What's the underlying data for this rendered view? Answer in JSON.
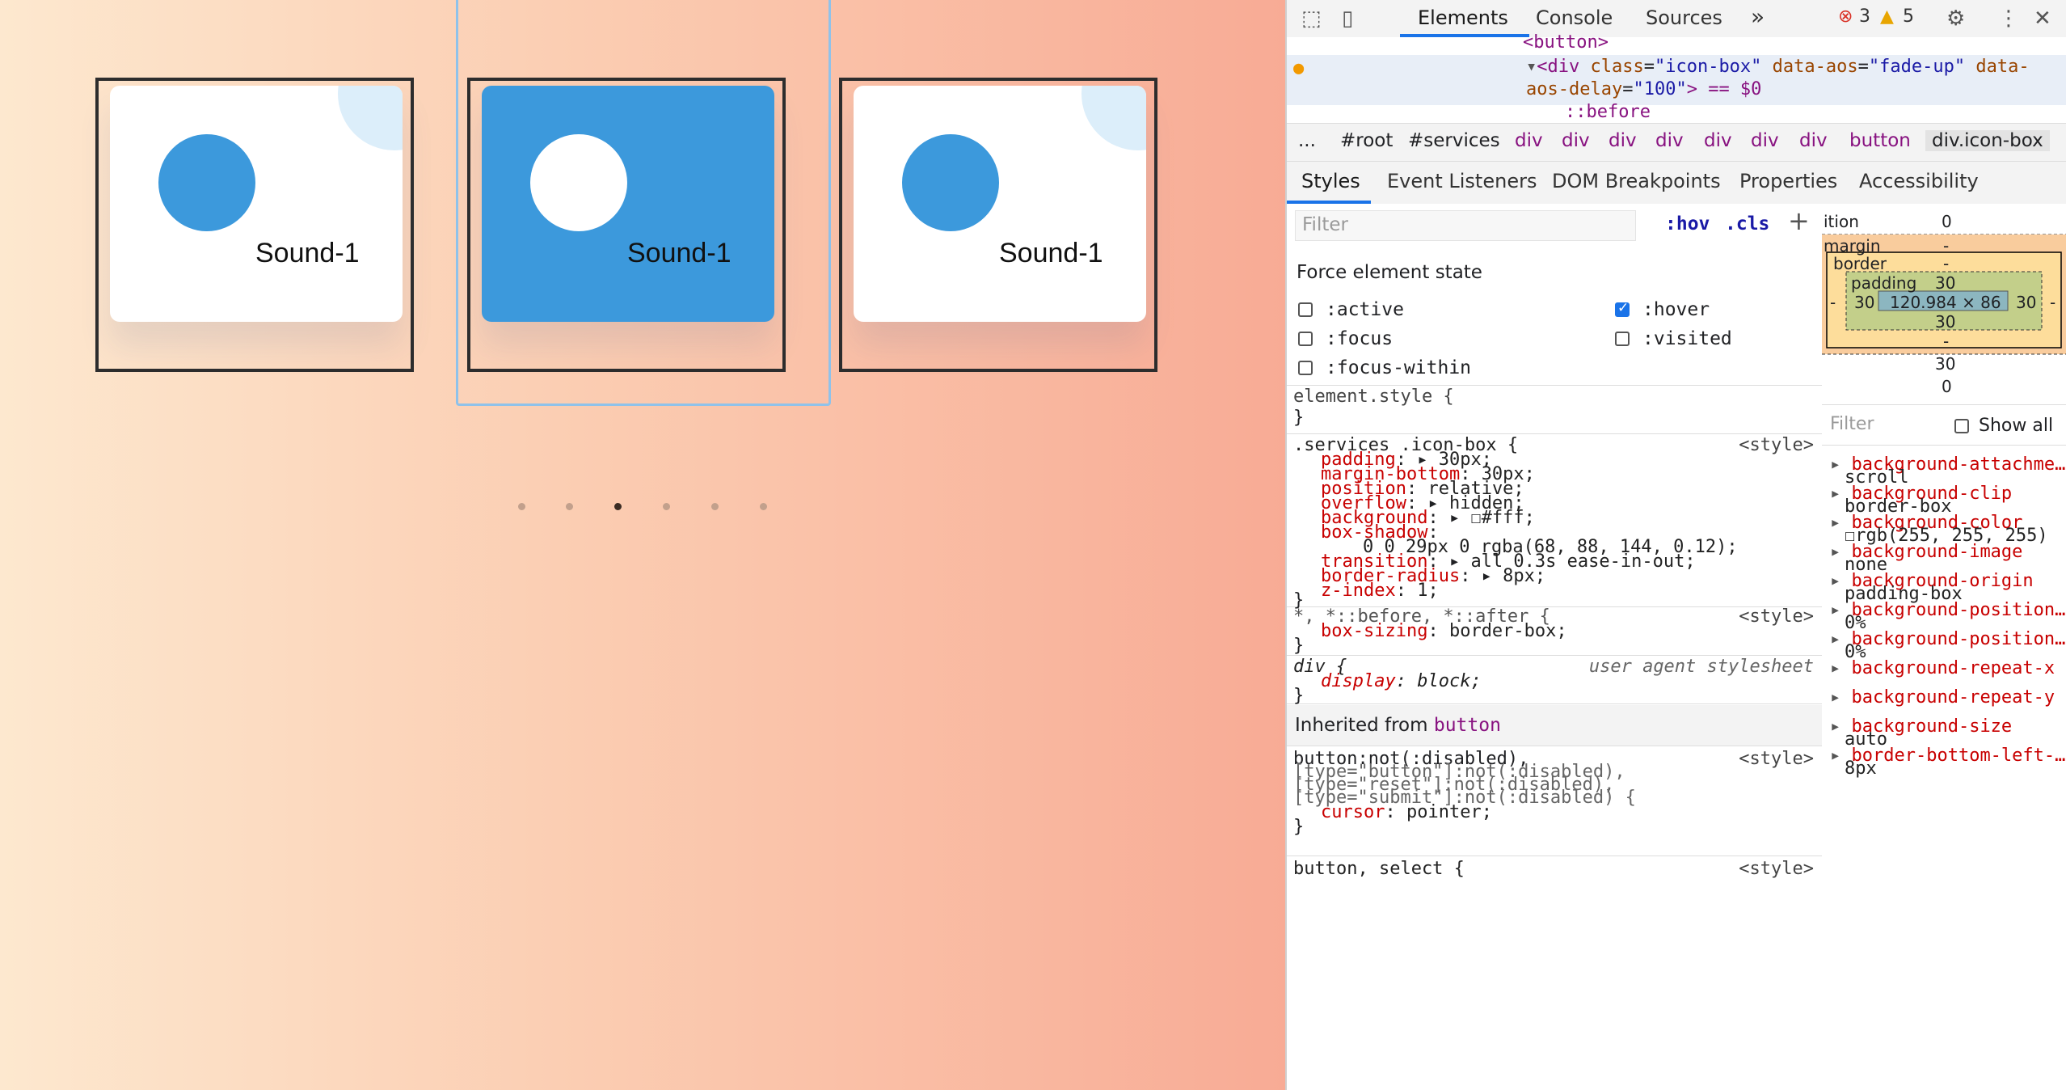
{
  "page": {
    "cards": [
      {
        "title": "Sound-1",
        "active": false
      },
      {
        "title": "Sound-1",
        "active": true
      },
      {
        "title": "Sound-1",
        "active": false
      }
    ],
    "dots_count": 6,
    "active_dot": 3
  },
  "devtools": {
    "tabs": [
      "Elements",
      "Console",
      "Sources"
    ],
    "more_tabs": "»",
    "errors": "3",
    "warnings": "5",
    "dom": {
      "line1": "<button>",
      "line2_tag": "<div ",
      "line2_attr1": "class",
      "line2_val1": "\"icon-box\"",
      "line2_attr2": "data-aos",
      "line2_val2": "\"fade-up\"",
      "line2_attr3": "data-",
      "line3_attr": "aos-delay",
      "line3_val": "\"100\"",
      "line3_rest": "> == $0",
      "line4": "::before"
    },
    "breadcrumb": [
      "...",
      "#root",
      "#services",
      "div",
      "div",
      "div",
      "div",
      "div",
      "div",
      "div",
      "button",
      "div.icon-box"
    ],
    "subtabs": [
      "Styles",
      "Event Listeners",
      "DOM Breakpoints",
      "Properties",
      "Accessibility"
    ],
    "filter_placeholder": "Filter",
    "hov": ":hov",
    "cls": ".cls",
    "force_state_title": "Force element state",
    "states": {
      "active": ":active",
      "focus": ":focus",
      "focus_within": ":focus-within",
      "hover": ":hover",
      "visited": ":visited"
    },
    "element_style": "element.style {",
    "close_brace": "}",
    "rule1": {
      "selector": ".services .icon-box {",
      "source": "<style>",
      "props": [
        {
          "p": "padding",
          "v": "30px;"
        },
        {
          "p": "margin-bottom",
          "v": "30px;"
        },
        {
          "p": "position",
          "v": "relative;"
        },
        {
          "p": "overflow",
          "v": "hidden;"
        },
        {
          "p": "background",
          "v": "#fff;"
        },
        {
          "p": "box-shadow",
          "v": ""
        },
        {
          "p": "",
          "v": "0 0 29px 0 rgba(68, 88, 144, 0.12);"
        },
        {
          "p": "transition",
          "v": "all 0.3s ease-in-out;"
        },
        {
          "p": "border-radius",
          "v": "8px;"
        },
        {
          "p": "z-index",
          "v": "1;"
        }
      ]
    },
    "rule2": {
      "selector": "*, *::before, *::after {",
      "source": "<style>",
      "prop": "box-sizing",
      "val": "border-box;"
    },
    "rule3": {
      "selector": "div {",
      "source": "user agent stylesheet",
      "prop": "display",
      "val": "block;"
    },
    "inherited_label": "Inherited from",
    "inherited_from": "button",
    "rule4": {
      "sel1": "button:not(:disabled),",
      "sel2": "[type=\"button\"]:not(:disabled),",
      "sel3": "[type=\"reset\"]:not(:disabled),",
      "sel4": "[type=\"submit\"]:not(:disabled) {",
      "source": "<style>",
      "prop": "cursor",
      "val": "pointer;"
    },
    "rule5": {
      "selector": "button, select {",
      "source": "<style>"
    },
    "boxmodel": {
      "position_label": "ition",
      "position_val": "0",
      "margin_label": "margin",
      "margin_top": "-",
      "border_label": "border",
      "border_top": "-",
      "padding_label": "padding",
      "padding_top": "30",
      "padding_left": "30",
      "padding_right": "30",
      "padding_bottom": "30",
      "content": "120.984 × 86",
      "border_left": "-",
      "border_right": "-",
      "border_bottom": "-",
      "margin_bottom": "30",
      "position_bottom": "0"
    },
    "computed": {
      "filter": "Filter",
      "show_all": "Show all",
      "props": [
        {
          "p": "background-attachme…",
          "v": "scroll"
        },
        {
          "p": "background-clip",
          "v": "border-box"
        },
        {
          "p": "background-color",
          "v": "rgb(255, 255, 255)"
        },
        {
          "p": "background-image",
          "v": "none"
        },
        {
          "p": "background-origin",
          "v": "padding-box"
        },
        {
          "p": "background-position…",
          "v": "0%"
        },
        {
          "p": "background-position…",
          "v": "0%"
        },
        {
          "p": "background-repeat-x",
          "v": ""
        },
        {
          "p": "background-repeat-y",
          "v": ""
        },
        {
          "p": "background-size",
          "v": "auto"
        },
        {
          "p": "border-bottom-left-…",
          "v": "8px"
        }
      ]
    },
    "colors": {
      "accent": "#1a73e8",
      "card_blue": "#3c99dc"
    }
  }
}
